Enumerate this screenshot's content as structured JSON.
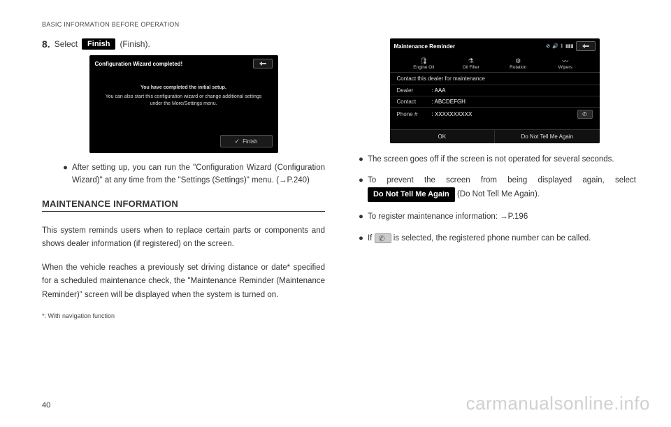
{
  "header": "BASIC INFORMATION BEFORE OPERATION",
  "left": {
    "step_num": "8.",
    "step_text_pre": "Select",
    "step_btn": "Finish",
    "step_text_post": "(Finish).",
    "ss1": {
      "title": "Configuration Wizard completed!",
      "body_bold": "You have completed the initial setup.",
      "body_line": "You can also start this configuration wizard or change additional settings under the More/Settings menu.",
      "finish_btn": "Finish"
    },
    "bullet1": "After setting up, you can run the \"Configuration Wizard (Configuration Wizard)\" at any time from the \"Settings (Settings)\" menu. (→P.240)",
    "section_heading": "MAINTENANCE INFORMATION",
    "para1": "This system reminds users when to replace certain parts or components and shows dealer information (if registered) on the screen.",
    "para2": "When the vehicle reaches a previously set driving distance or date* specified for a scheduled maintenance check, the \"Maintenance Reminder (Maintenance Reminder)\" screen will be displayed when the system is turned on.",
    "footnote": "*:   With navigation function"
  },
  "right": {
    "ss2": {
      "title": "Maintenance Reminder",
      "tabs": [
        "Engine Oil",
        "Oil Filter",
        "Rotation",
        "Wipers"
      ],
      "contact_line": "Contact this dealer for maintenance",
      "rows": [
        {
          "label": "Dealer",
          "value": ": AAA"
        },
        {
          "label": "Contact",
          "value": ": ABCDEFGH"
        },
        {
          "label": "Phone #",
          "value": ": XXXXXXXXXX"
        }
      ],
      "footer": [
        "OK",
        "Do Not Tell Me Again"
      ]
    },
    "bullet1": "The screen goes off if the screen is not operated for several seconds.",
    "bullet2_pre": "To prevent the screen from being displayed again, select ",
    "bullet2_btn": "Do Not Tell Me Again",
    "bullet2_post": " (Do Not Tell Me Again).",
    "bullet3": "To register maintenance information: →P.196",
    "bullet4_pre": "If ",
    "bullet4_post": " is selected, the registered phone number can be called."
  },
  "page_num": "40",
  "watermark": "carmanualsonline.info"
}
